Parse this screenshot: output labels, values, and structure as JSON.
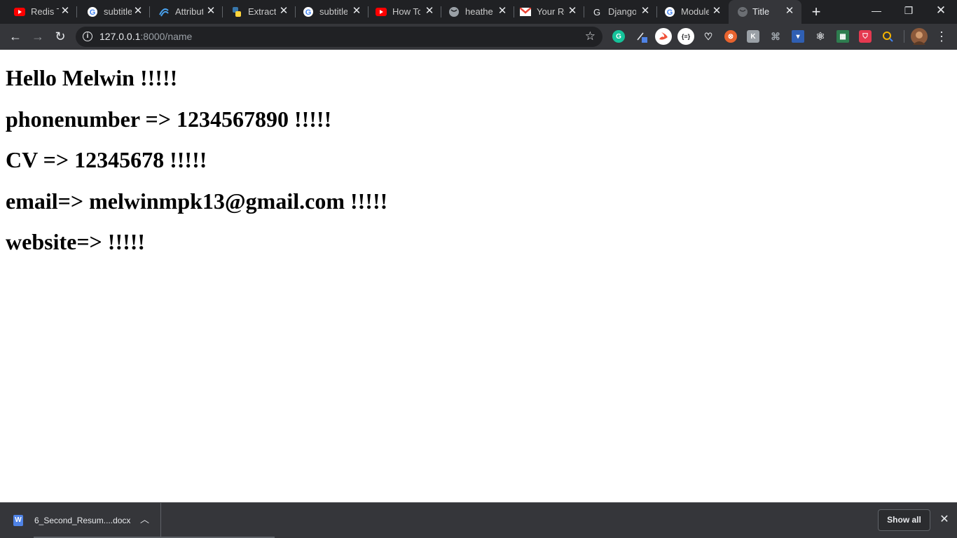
{
  "browser": {
    "tabs": [
      {
        "title": "Redis T",
        "icon": "youtube-icon"
      },
      {
        "title": "subtitle",
        "icon": "google-icon"
      },
      {
        "title": "Attribut",
        "icon": "wave-icon"
      },
      {
        "title": "Extract",
        "icon": "python-icon"
      },
      {
        "title": "subtitle",
        "icon": "google-icon"
      },
      {
        "title": "How To",
        "icon": "youtube-icon"
      },
      {
        "title": "heather",
        "icon": "globe-icon"
      },
      {
        "title": "Your Re",
        "icon": "gmail-icon"
      },
      {
        "title": "Django",
        "icon": "g-letter-icon"
      },
      {
        "title": "Module",
        "icon": "google-icon"
      },
      {
        "title": "Title",
        "icon": "globe-icon",
        "active": true
      }
    ],
    "url_host": "127.0.0.1",
    "url_path": ":8000/name"
  },
  "page": {
    "line1": "Hello Melwin !!!!!",
    "line2": "phonenumber => 1234567890 !!!!!",
    "line3": "CV => 12345678 !!!!!",
    "line4": "email=> melwinmpk13@gmail.com !!!!!",
    "line5": "website=> !!!!!"
  },
  "downloads": {
    "filename": "6_Second_Resum....docx",
    "show_all": "Show all"
  }
}
